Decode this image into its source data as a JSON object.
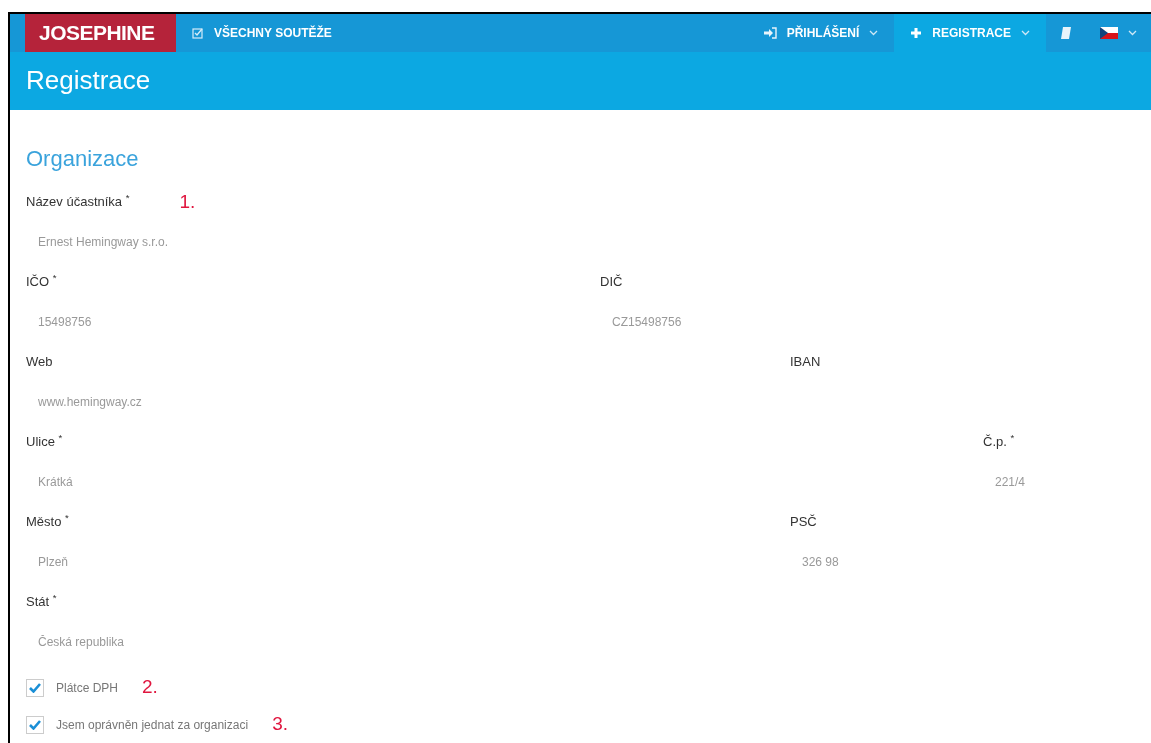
{
  "navbar": {
    "logo": "JOSEPHINE",
    "items": [
      {
        "kind": "competitions",
        "label": "VŠECHNY SOUTĚŽE",
        "selected": false,
        "dropdown": false
      },
      {
        "kind": "login",
        "label": "PŘIHLÁŠENÍ",
        "selected": false,
        "dropdown": true
      },
      {
        "kind": "register",
        "label": "REGISTRACE",
        "selected": true,
        "dropdown": true
      },
      {
        "kind": "manual",
        "selected": false,
        "dropdown": false
      },
      {
        "kind": "language",
        "selected": false,
        "dropdown": true
      }
    ]
  },
  "page_title": "Registrace",
  "section_title": "Organizace",
  "form_rows": [
    [
      {
        "label": "Název účastníka $^{*}$",
        "value": "Ernest Hemingway s.r.o.",
        "annotation": "1."
      }
    ],
    [
      {
        "label": "IČO $^{*}$",
        "value": "15498756"
      },
      {
        "label": "DIČ",
        "value": "CZ15498756"
      }
    ],
    [
      {
        "label": "Web",
        "value": "www.hemingway.cz"
      },
      {
        "label": "IBAN"
      }
    ],
    [
      {
        "label": "Ulice $^{*}$",
        "value": "Krátká"
      },
      {
        "label": "Č.p. $^{*}$",
        "value": "221/4"
      }
    ],
    [
      {
        "label": "Město $^{*}$",
        "value": "Plzeň"
      },
      {
        "label": "PSČ",
        "value": "326 98"
      }
    ],
    [
      {
        "label": "Stát $^{*}$",
        "value": "Česká republika"
      }
    ]
  ],
  "checkboxes": [
    {
      "label": "Plátce DPH",
      "checked": true,
      "annotation": "2."
    },
    {
      "label": "Jsem oprávněn jednat za organizaci",
      "checked": true,
      "annotation": "3."
    }
  ]
}
